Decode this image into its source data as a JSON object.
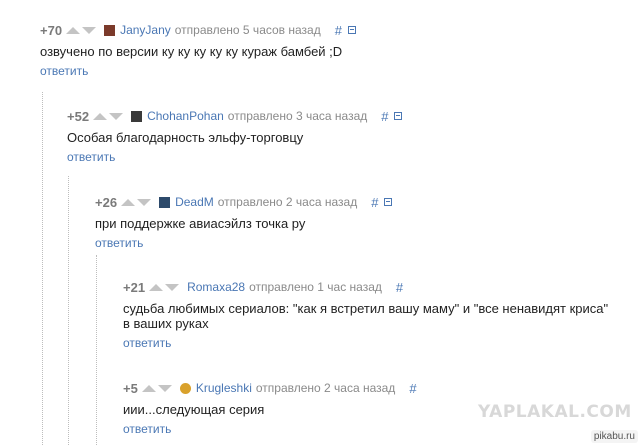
{
  "comments": [
    {
      "rating": "+70",
      "user": "JanyJany",
      "meta": "отправлено 5 часов назад",
      "hash": "#",
      "text": "озвучено по версии ку ку ку ку ку кураж бамбей ;D",
      "reply": "ответить"
    },
    {
      "rating": "+52",
      "user": "ChohanPohan",
      "meta": "отправлено 3 часа назад",
      "hash": "#",
      "text": "Особая благодарность эльфу-торговцу",
      "reply": "ответить"
    },
    {
      "rating": "+26",
      "user": "DeadM",
      "meta": "отправлено 2 часа назад",
      "hash": "#",
      "text": "при поддержке авиасэйлз точка ру",
      "reply": "ответить"
    },
    {
      "rating": "+21",
      "user": "Romaxa28",
      "meta": "отправлено 1 час назад",
      "hash": "#",
      "text": "судьба любимых сериалов: \"как я встретил вашу маму\" и \"все ненавидят криса\" в ваших руках",
      "reply": "ответить"
    },
    {
      "rating": "+5",
      "user": "Krugleshki",
      "meta": "отправлено 2 часа назад",
      "hash": "#",
      "text": "иии...следующая серия",
      "reply": "ответить"
    }
  ],
  "watermark": "YAPLAKAL.COM",
  "brand": "pikabu.ru"
}
